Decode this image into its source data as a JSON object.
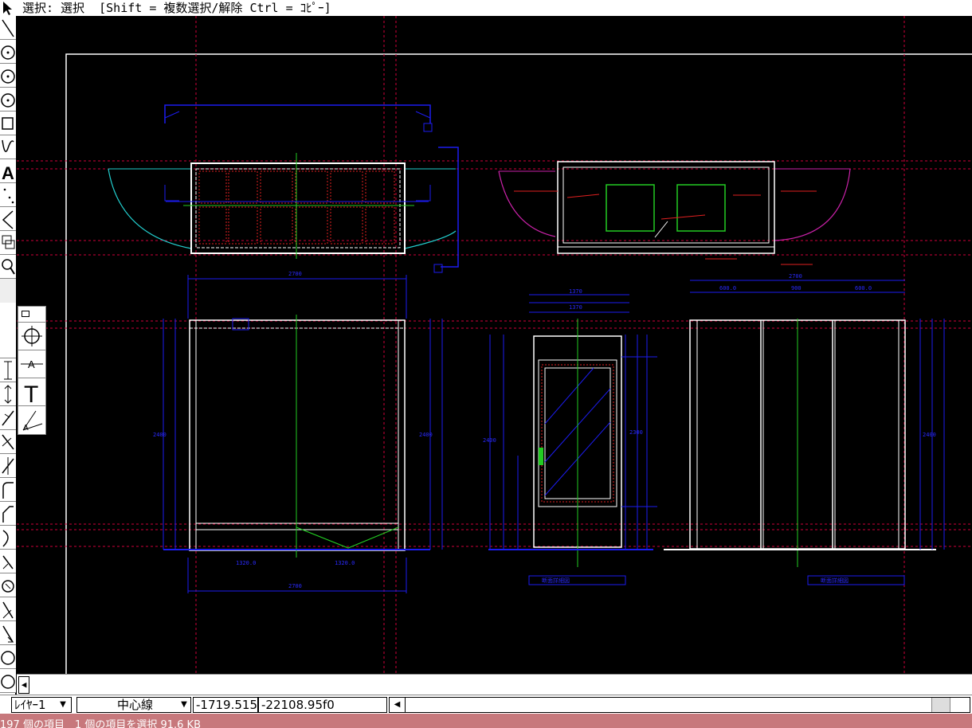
{
  "prompt": {
    "text": "選択: 選択  [Shift = 複数選択/解除 Ctrl = ｺﾋﾟｰ]"
  },
  "toolbar": {
    "tools": [
      "select-arrow-icon",
      "line-icon",
      "arc-icon",
      "circle-icon",
      "ellipse-icon",
      "rectangle-icon",
      "spline-icon",
      "text-icon",
      "point-icon",
      "angle-icon",
      "copy-icon",
      "zoom-icon",
      "dimension-icon",
      "move-icon",
      "offset-icon",
      "trim-icon",
      "extend-icon",
      "fillet-icon",
      "chamfer-icon",
      "measure-icon",
      "rotate-icon",
      "mirror-icon",
      "scale-icon",
      "stretch-icon",
      "hatch-icon",
      "erase-icon"
    ]
  },
  "palette": {
    "tools": [
      "crosshair-snap-icon",
      "dimension-text-icon",
      "text-tool-icon",
      "angular-dimension-icon"
    ]
  },
  "drawing": {
    "labels": {
      "label_left_plan_width": "2700",
      "label_front_width": "2700",
      "label_front_bottom_total": "2700",
      "label_front_bottom_a": "1320.0",
      "label_front_bottom_b": "1320.0",
      "label_front_height": "2400",
      "label_front_height_right": "2400",
      "label_side_width": "1370",
      "label_side_sub_a": "1370",
      "label_side_height": "2300",
      "label_side_h2": "2400",
      "label_right_top": "2700",
      "label_right_a": "600.0",
      "label_right_b": "900",
      "label_right_c": "600.0",
      "label_right_height": "2400",
      "label_title_mid": "断面詳細図",
      "label_title_right": "断面詳細図"
    }
  },
  "statusbar": {
    "layer": "ﾚｲﾔｰ1",
    "linetype": "中心線",
    "coord_x": "-1719.515",
    "coord_y": "-22108.95",
    "coord_tail": "f0"
  },
  "explorer": {
    "text": "197 個の項目　1 個の項目を選択 91.6 KB"
  },
  "colors": {
    "background": "#000000",
    "frame": "#ffffff",
    "guide": "#d0003a",
    "blue_dim": "#1c1cf0",
    "green_center": "#22cc22",
    "cyan": "#22cccc",
    "magenta": "#cc22aa",
    "red_hatch": "#e02020"
  }
}
